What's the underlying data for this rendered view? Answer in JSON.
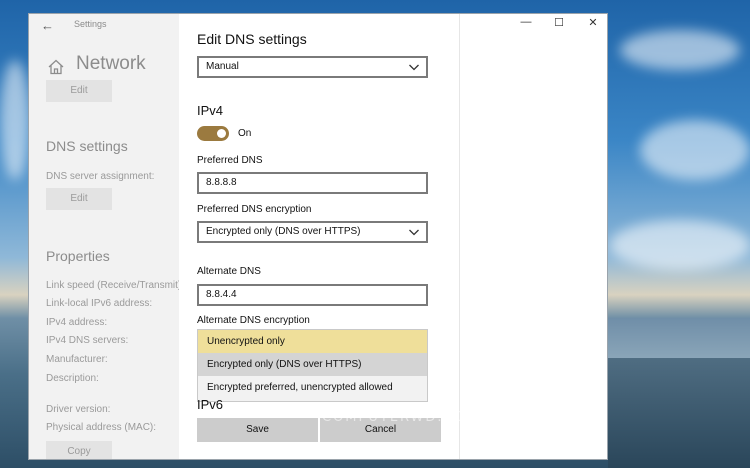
{
  "window": {
    "back_glyph": "←",
    "title": "Settings",
    "controls": {
      "minimize": "—",
      "maximize": "☐",
      "close": "✕"
    }
  },
  "left": {
    "home_icon": "home-icon",
    "page_title": "Network",
    "edit1": "Edit",
    "dns_heading": "DNS settings",
    "dns_assign_label": "DNS server assignment:",
    "edit2": "Edit",
    "props_heading": "Properties",
    "props": [
      "Link speed (Receive/Transmit):",
      "Link-local IPv6 address:",
      "IPv4 address:",
      "IPv4 DNS servers:",
      "Manufacturer:",
      "Description:"
    ],
    "driver_version": "Driver version:",
    "mac": "Physical address (MAC):",
    "copy": "Copy"
  },
  "dialog": {
    "title": "Edit DNS settings",
    "mode_value": "Manual",
    "ipv4_heading": "IPv4",
    "toggle_label": "On",
    "toggle_on": true,
    "preferred_label": "Preferred DNS",
    "preferred_value": "8.8.8.8",
    "pref_enc_label": "Preferred DNS encryption",
    "pref_enc_value": "Encrypted only (DNS over HTTPS)",
    "alternate_label": "Alternate DNS",
    "alternate_value": "8.8.4.4",
    "alt_enc_label": "Alternate DNS encryption",
    "options": [
      "Unencrypted only",
      "Encrypted only (DNS over HTTPS)",
      "Encrypted preferred, unencrypted allowed"
    ],
    "ipv6_heading": "IPv6",
    "save": "Save",
    "cancel": "Cancel"
  },
  "watermark": "COMPUTERWD.COM",
  "colors": {
    "toggle": "#9b7a3f",
    "highlight": "#efdf9a",
    "hover": "#d4d4d4"
  }
}
